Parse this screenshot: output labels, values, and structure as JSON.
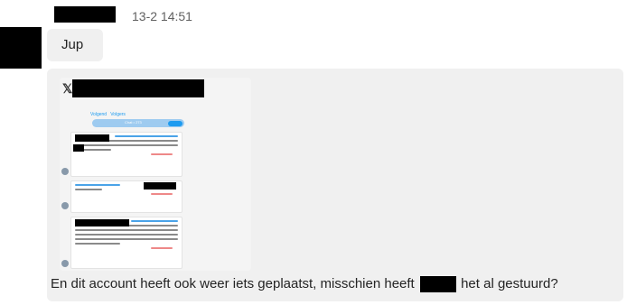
{
  "message": {
    "timestamp": "13-2 14:51",
    "text_short": "Jup",
    "caption_before": "En dit account heeft ook weer iets geplaatst, misschien heeft",
    "caption_after": "het al gestuurd?"
  },
  "thumbnail": {
    "logo": "𝕏",
    "follow_text": "Volgend",
    "followers_text": "Volgers",
    "pill_text": "Chat • 273",
    "actions_text": "♥ Reactie  ⟲ Repost  ♥ Leuk"
  },
  "colors": {
    "bubble": "#f0f0f0",
    "timestamp": "#616161",
    "link": "#1d9bf0"
  }
}
